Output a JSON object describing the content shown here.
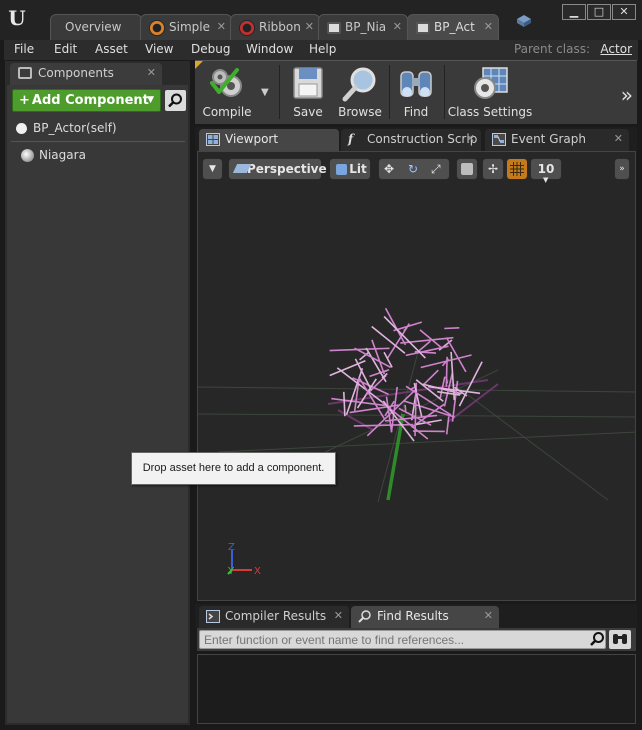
{
  "app": {
    "logo": "U"
  },
  "doc_tabs": [
    {
      "label": "Overview",
      "icon": "none"
    },
    {
      "label": "Simple",
      "icon": "particle-system-icon"
    },
    {
      "label": "Ribbon",
      "icon": "particle-system-icon"
    },
    {
      "label": "BP_Nia",
      "icon": "blueprint-book-icon"
    },
    {
      "label": "BP_Act",
      "icon": "blueprint-book-icon"
    }
  ],
  "window_controls": {
    "minimize": "▁",
    "maximize": "□",
    "close": "✕"
  },
  "menu": {
    "items": [
      "File",
      "Edit",
      "Asset",
      "View",
      "Debug",
      "Window",
      "Help"
    ],
    "parent_class_label": "Parent class:",
    "parent_class_value": "Actor"
  },
  "components_panel": {
    "tab_label": "Components",
    "close": "✕",
    "add_button": "Add Component",
    "self_item": "BP_Actor(self)",
    "children": [
      "Niagara"
    ]
  },
  "toolbar": {
    "compile": "Compile",
    "save": "Save",
    "browse": "Browse",
    "find": "Find",
    "class_settings": "Class Settings",
    "overflow": "»"
  },
  "editor_tabs": [
    {
      "label": "Viewport"
    },
    {
      "label": "Construction Scrip"
    },
    {
      "label": "Event Graph"
    }
  ],
  "viewport": {
    "perspective": "Perspective",
    "lit": "Lit",
    "grid_snap_value": "10",
    "axis_x": "X",
    "axis_y": "Y",
    "axis_z": "Z"
  },
  "bottom_tabs": [
    {
      "label": "Compiler Results"
    },
    {
      "label": "Find Results"
    }
  ],
  "find": {
    "placeholder": "Enter function or event name to find references..."
  },
  "tooltip": {
    "text": "Drop asset here to add a component."
  },
  "colors": {
    "add_button": "#4e9c2b",
    "particles": "#e38ee0",
    "grid_snap_active": "#c47a1a"
  }
}
